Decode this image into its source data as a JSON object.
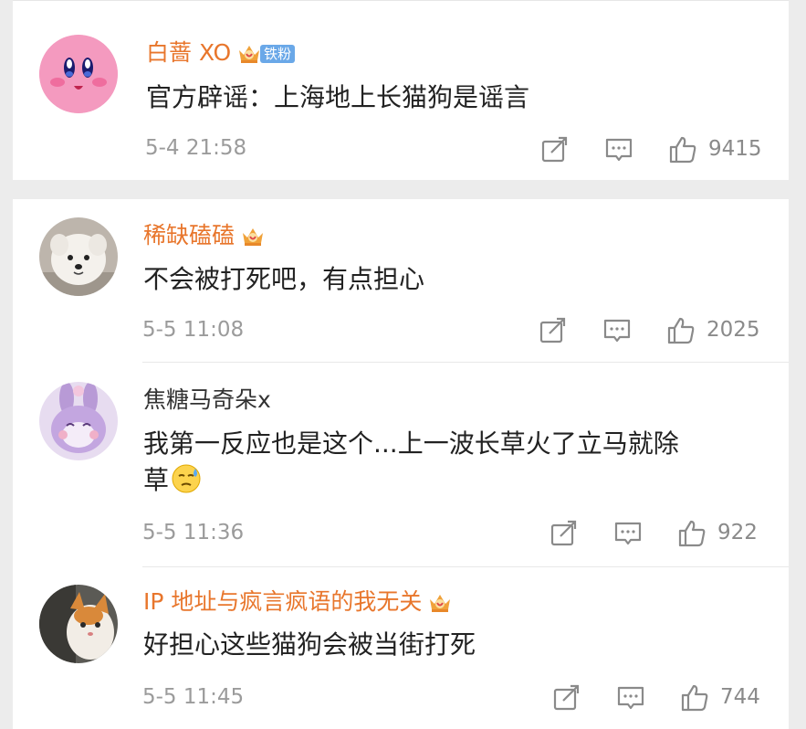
{
  "comments": [
    {
      "username": "白蔷 XO",
      "fan_tag": "铁粉",
      "text": "官方辟谣：上海地上长猫狗是谣言",
      "time": "5-4 21:58",
      "likes": "9415",
      "avatar": "kirby-avatar",
      "name_color": "#e8762c"
    },
    {
      "username": "稀缺磕磕",
      "text": "不会被打死吧，有点担心",
      "time": "5-5 11:08",
      "likes": "2025",
      "avatar": "white-dog-avatar",
      "name_color": "#e8762c"
    },
    {
      "username": "焦糖马奇朵x",
      "text": "我第一反应也是这个...上一波长草火了立马就除",
      "text_line2": "草",
      "time": "5-5 11:36",
      "likes": "922",
      "avatar": "purple-bunny-avatar",
      "name_color": "#333333"
    },
    {
      "username": "IP 地址与疯言疯语的我无关",
      "text": "好担心这些猫狗会被当街打死",
      "time": "5-5 11:45",
      "likes": "744",
      "avatar": "cat-avatar",
      "name_color": "#e8762c"
    }
  ],
  "colors": {
    "vip_name": "#e8762c",
    "fan_tag_bg": "#6aa8e8",
    "text": "#222222",
    "meta": "#9b9b9b",
    "background": "#ececec"
  },
  "icons": [
    "vip-crown-icon",
    "repost-icon",
    "comment-icon",
    "like-icon",
    "sweat-emoji-icon"
  ]
}
